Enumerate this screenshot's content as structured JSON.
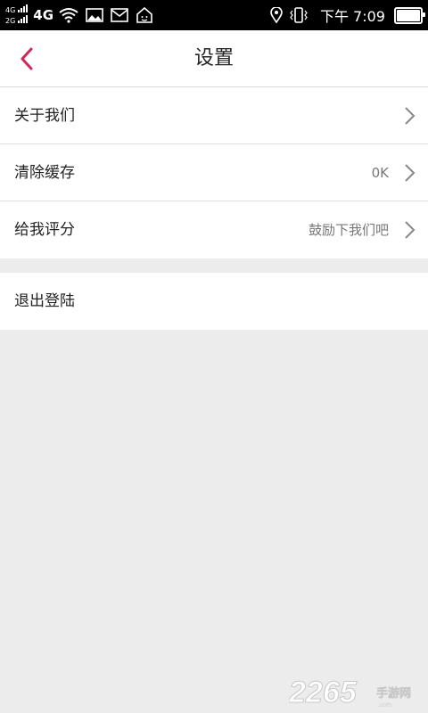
{
  "status_bar": {
    "net_top": "4G",
    "net_bottom": "2G",
    "net_type": "4G",
    "icons": [
      "signal-icon",
      "wifi-icon",
      "image-icon",
      "mail-icon",
      "home-robot-icon",
      "location-icon",
      "vibrate-icon",
      "battery-icon"
    ],
    "time": "下午 7:09"
  },
  "header": {
    "title": "设置",
    "back_icon": "chevron-left-icon",
    "accent_color": "#d0285a"
  },
  "settings": {
    "items": [
      {
        "label": "关于我们",
        "value": ""
      },
      {
        "label": "清除缓存",
        "value": "0K"
      },
      {
        "label": "给我评分",
        "value": "鼓励下我们吧"
      }
    ],
    "logout_label": "退出登陆"
  },
  "watermark": "2265.com 手游网"
}
